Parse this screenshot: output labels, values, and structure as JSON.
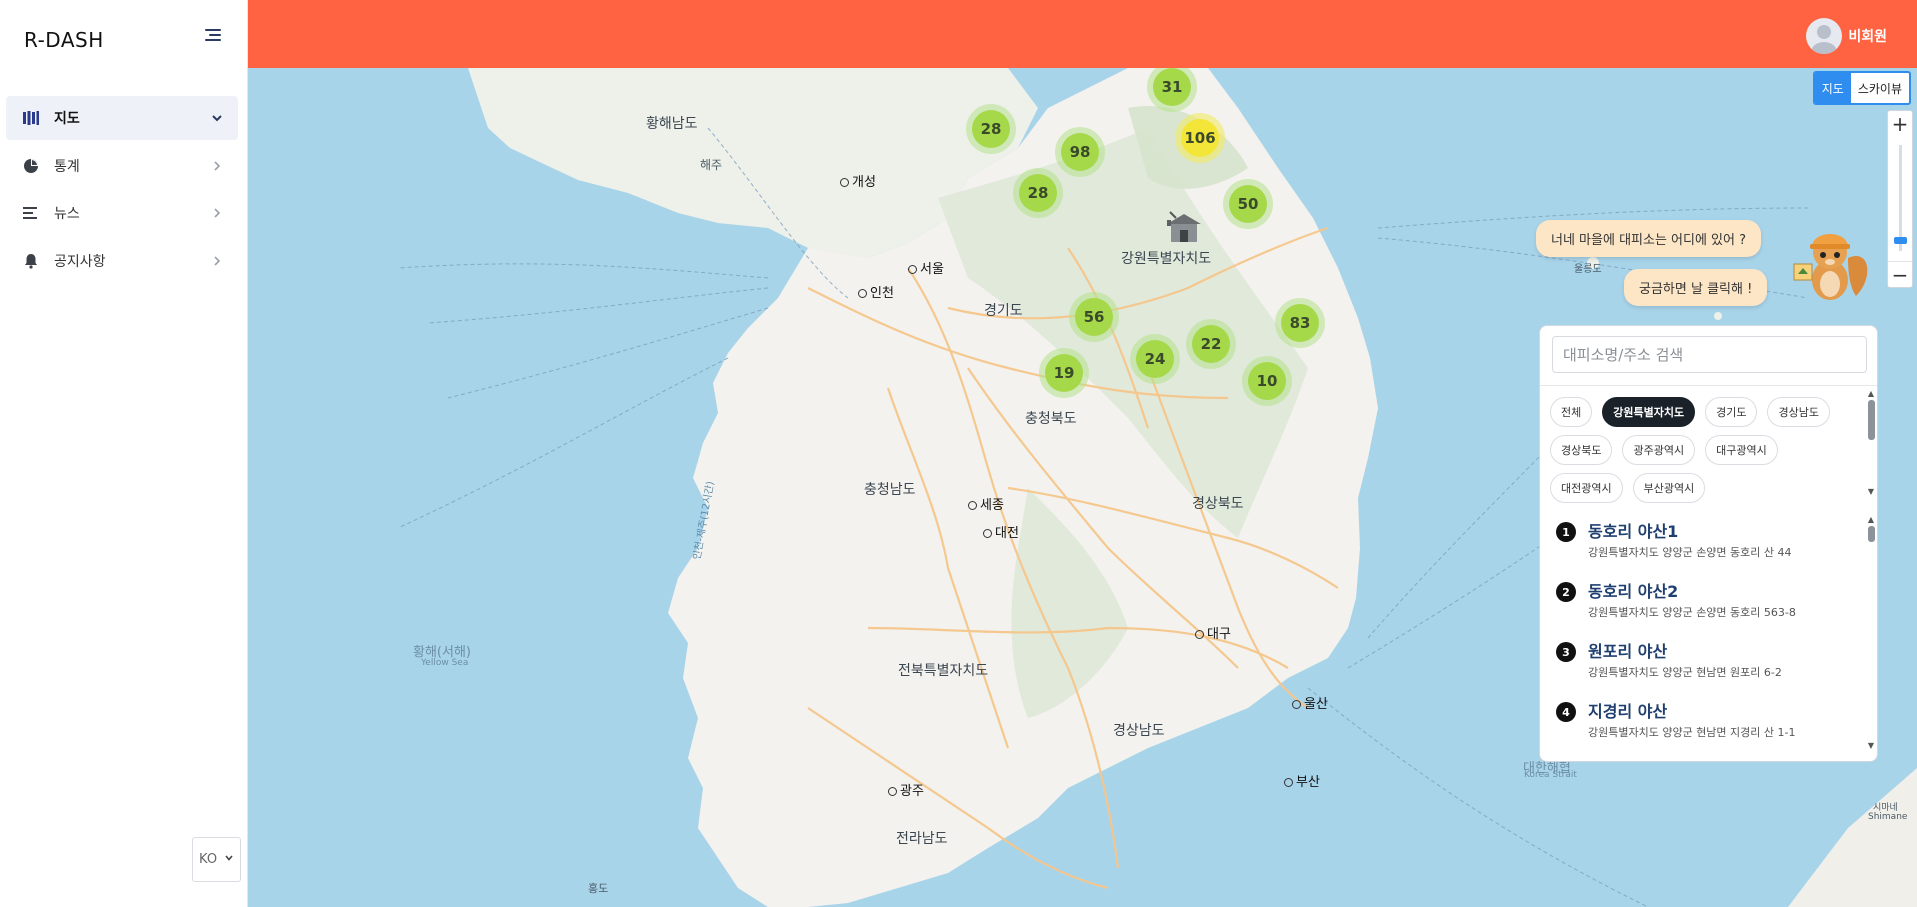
{
  "app": {
    "brand": "R-DASH"
  },
  "sidebar": {
    "items": [
      {
        "label": "지도",
        "icon": "map-icon",
        "active": true
      },
      {
        "label": "통계",
        "icon": "pie-chart-icon",
        "active": false
      },
      {
        "label": "뉴스",
        "icon": "news-icon",
        "active": false
      },
      {
        "label": "공지사항",
        "icon": "bell-icon",
        "active": false
      }
    ],
    "language": "KO"
  },
  "header": {
    "user_name": "비회원",
    "color": "#ff6341"
  },
  "map": {
    "view_toggle": {
      "map": "지도",
      "skyview": "스카이뷰",
      "selected": "지도"
    },
    "zoom_in": "+",
    "zoom_out": "−",
    "labels": {
      "hwanghae_do": "황해남도",
      "gaeseong": "개성",
      "haeju": "해주",
      "seoul": "서울",
      "incheon": "인천",
      "gyeonggi": "경기도",
      "gangwon": "강원특별자치도",
      "chungbuk": "충청북도",
      "chungnam": "충청남도",
      "sejong": "세종",
      "daejeon": "대전",
      "gyeongbuk": "경상북도",
      "daegu": "대구",
      "jeonbuk": "전북특별자치도",
      "gyeongnam": "경상남도",
      "ulsan": "울산",
      "busan": "부산",
      "gwangju": "광주",
      "jeonnam": "전라남도",
      "yellow_sea": "황해(서해)",
      "yellow_sea_en": "Yellow Sea",
      "korea_strait": "대한해협",
      "korea_strait_en": "Korea Strait",
      "ulleungdo": "울릉도",
      "shimane": "시마네",
      "shimane_en": "Shimane",
      "hongdo": "홍도",
      "jeju_route": "인천-제주(12시간)"
    },
    "clusters": [
      {
        "count": "31",
        "level": "normal"
      },
      {
        "count": "28",
        "level": "normal"
      },
      {
        "count": "98",
        "level": "normal"
      },
      {
        "count": "106",
        "level": "high"
      },
      {
        "count": "28",
        "level": "normal"
      },
      {
        "count": "50",
        "level": "normal"
      },
      {
        "count": "56",
        "level": "normal"
      },
      {
        "count": "83",
        "level": "normal"
      },
      {
        "count": "22",
        "level": "normal"
      },
      {
        "count": "24",
        "level": "normal"
      },
      {
        "count": "19",
        "level": "normal"
      },
      {
        "count": "10",
        "level": "normal"
      }
    ],
    "bubbles": {
      "question": "너네 마을에 대피소는 어디에 있어 ?",
      "prompt": "궁금하면 날 클릭해 !"
    }
  },
  "panel": {
    "search_placeholder": "대피소명/주소 검색",
    "chips": [
      {
        "label": "전체",
        "selected": false
      },
      {
        "label": "강원특별자치도",
        "selected": true
      },
      {
        "label": "경기도",
        "selected": false
      },
      {
        "label": "경상남도",
        "selected": false
      },
      {
        "label": "경상북도",
        "selected": false
      },
      {
        "label": "광주광역시",
        "selected": false
      },
      {
        "label": "대구광역시",
        "selected": false
      },
      {
        "label": "대전광역시",
        "selected": false
      },
      {
        "label": "부산광역시",
        "selected": false
      }
    ],
    "shelters": [
      {
        "num": "1",
        "name": "동호리 야산1",
        "address": "강원특별자치도 양양군 손양면 동호리 산 44"
      },
      {
        "num": "2",
        "name": "동호리 야산2",
        "address": "강원특별자치도 양양군 손양면 동호리 563-8"
      },
      {
        "num": "3",
        "name": "원포리 야산",
        "address": "강원특별자치도 양양군 현남면 원포리 6-2"
      },
      {
        "num": "4",
        "name": "지경리 야산",
        "address": "강원특별자치도 양양군 현남면 지경리 산 1-1"
      }
    ]
  }
}
